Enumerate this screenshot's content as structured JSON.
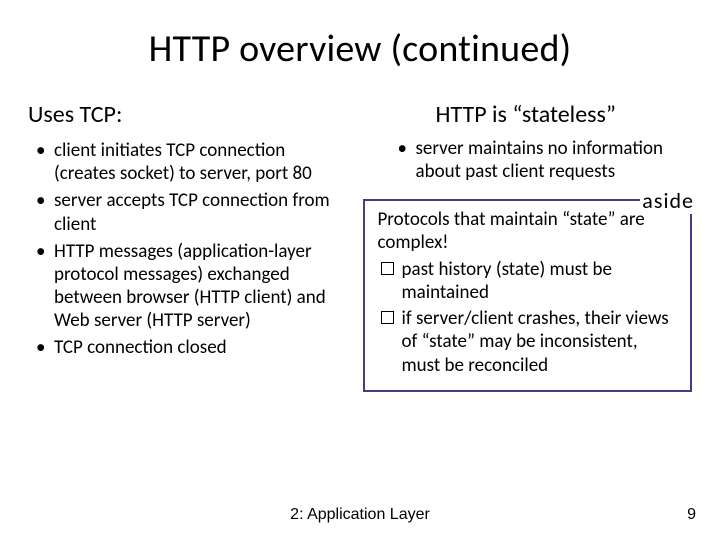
{
  "title": "HTTP overview (continued)",
  "left": {
    "heading": "Uses TCP:",
    "items": [
      "client initiates TCP connection (creates socket) to server, port 80",
      "server accepts TCP connection from client",
      "HTTP messages (application-layer protocol messages) exchanged between browser (HTTP client) and Web server (HTTP server)",
      "TCP connection closed"
    ]
  },
  "right": {
    "heading": "HTTP is “stateless”",
    "items": [
      "server maintains no information about past client requests"
    ],
    "aside": {
      "label": "aside",
      "lead": "Protocols that maintain “state” are complex!",
      "items": [
        "past history (state) must be maintained",
        "if server/client crashes, their views of “state” may be inconsistent, must be reconciled"
      ]
    }
  },
  "footer": {
    "center": "2: Application Layer",
    "page": "9"
  }
}
